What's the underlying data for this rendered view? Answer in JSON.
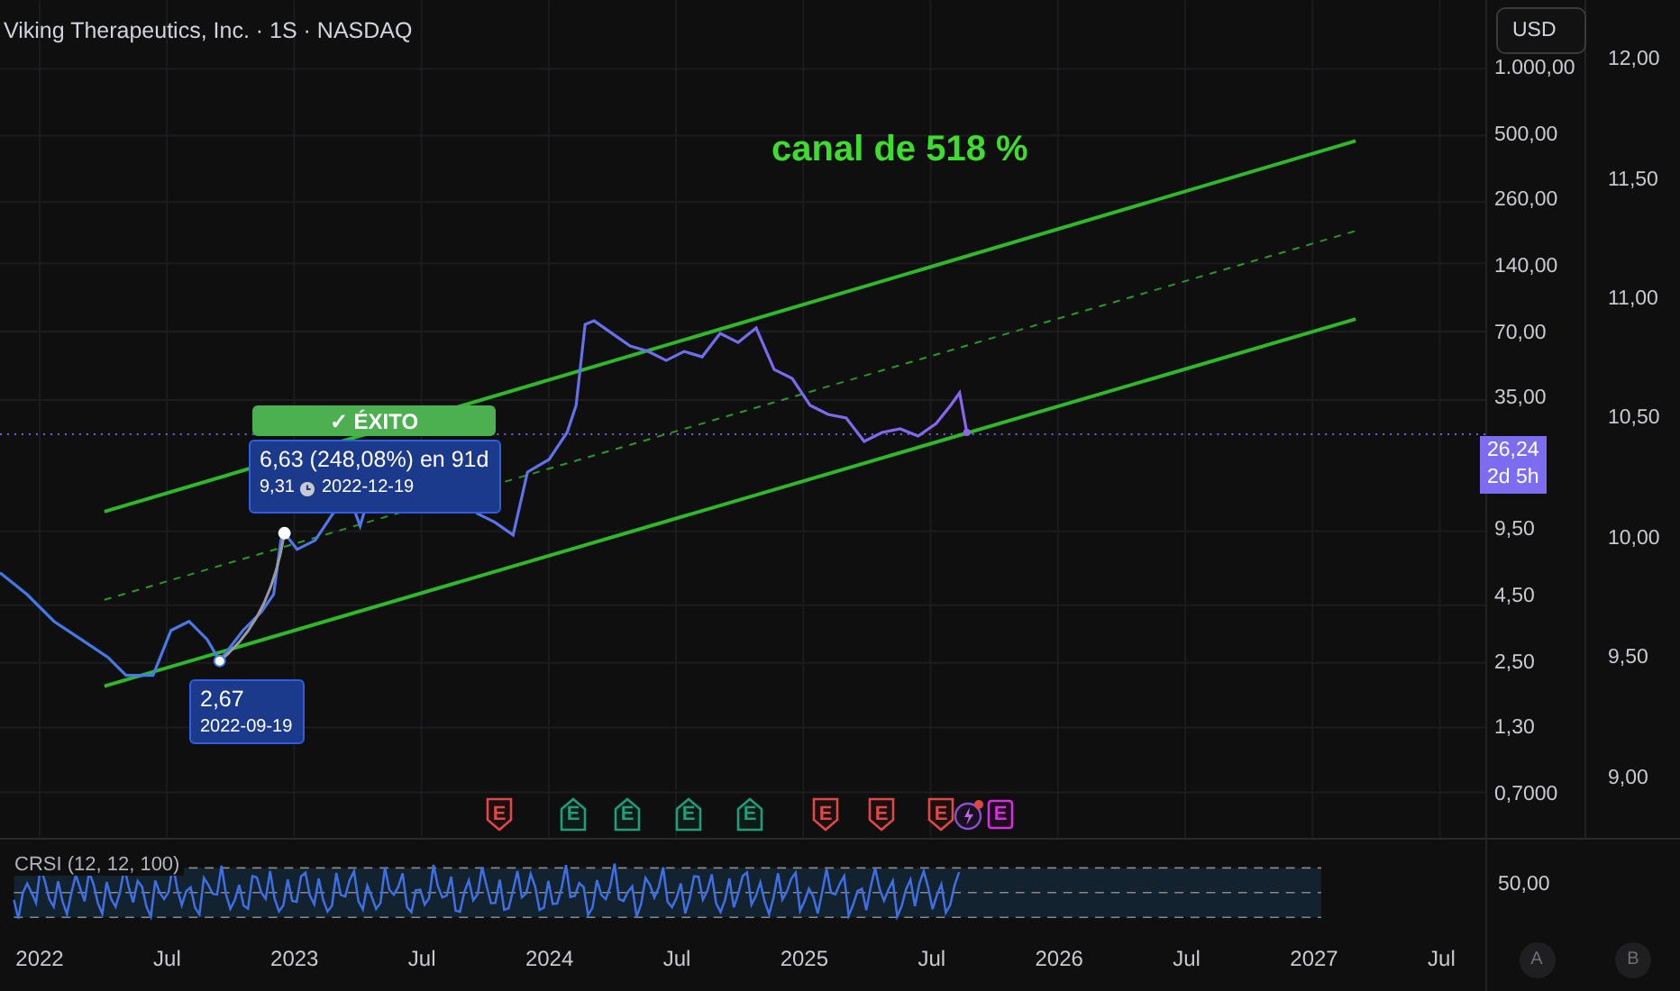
{
  "header": {
    "title": "Viking Therapeutics, Inc. · 1S · NASDAQ"
  },
  "currency_button": "USD",
  "annotation": "canal de 518 %",
  "measure": {
    "status": "✓ ÉXITO",
    "change": "6,63 (248,08%) en 91d",
    "end_price": "9,31",
    "end_date": "2022-12-19",
    "start_price": "2,67",
    "start_date": "2022-09-19"
  },
  "price_axis": {
    "labels": [
      "1.000,00",
      "500,00",
      "260,00",
      "140,00",
      "70,00",
      "35,00",
      "9,50",
      "4,50",
      "2,50",
      "1,30",
      "0,7000"
    ],
    "last_price": "26,24",
    "countdown": "2d 5h"
  },
  "secondary_axis": {
    "labels": [
      "12,00",
      "11,50",
      "11,00",
      "10,50",
      "10,00",
      "9,50",
      "9,00"
    ]
  },
  "earnings": [
    {
      "label": "E",
      "kind": "down",
      "color": "#e04848"
    },
    {
      "label": "E",
      "kind": "up",
      "color": "#1f9e7a"
    },
    {
      "label": "E",
      "kind": "up",
      "color": "#1f9e7a"
    },
    {
      "label": "E",
      "kind": "up",
      "color": "#1f9e7a"
    },
    {
      "label": "E",
      "kind": "up",
      "color": "#1f9e7a"
    },
    {
      "label": "E",
      "kind": "down",
      "color": "#e04848"
    },
    {
      "label": "E",
      "kind": "down",
      "color": "#e04848"
    },
    {
      "label": "E",
      "kind": "down",
      "color": "#e04848"
    },
    {
      "label": "E",
      "kind": "square",
      "color": "#d62ee0"
    }
  ],
  "indicator": {
    "title": "CRSI (12, 12, 100)",
    "axis_label": "50,00"
  },
  "time_axis": {
    "labels": [
      "2022",
      "Jul",
      "2023",
      "Jul",
      "2024",
      "Jul",
      "2025",
      "Jul",
      "2026",
      "Jul",
      "2027",
      "Jul"
    ]
  },
  "scale_buttons": [
    "A",
    "B"
  ]
}
